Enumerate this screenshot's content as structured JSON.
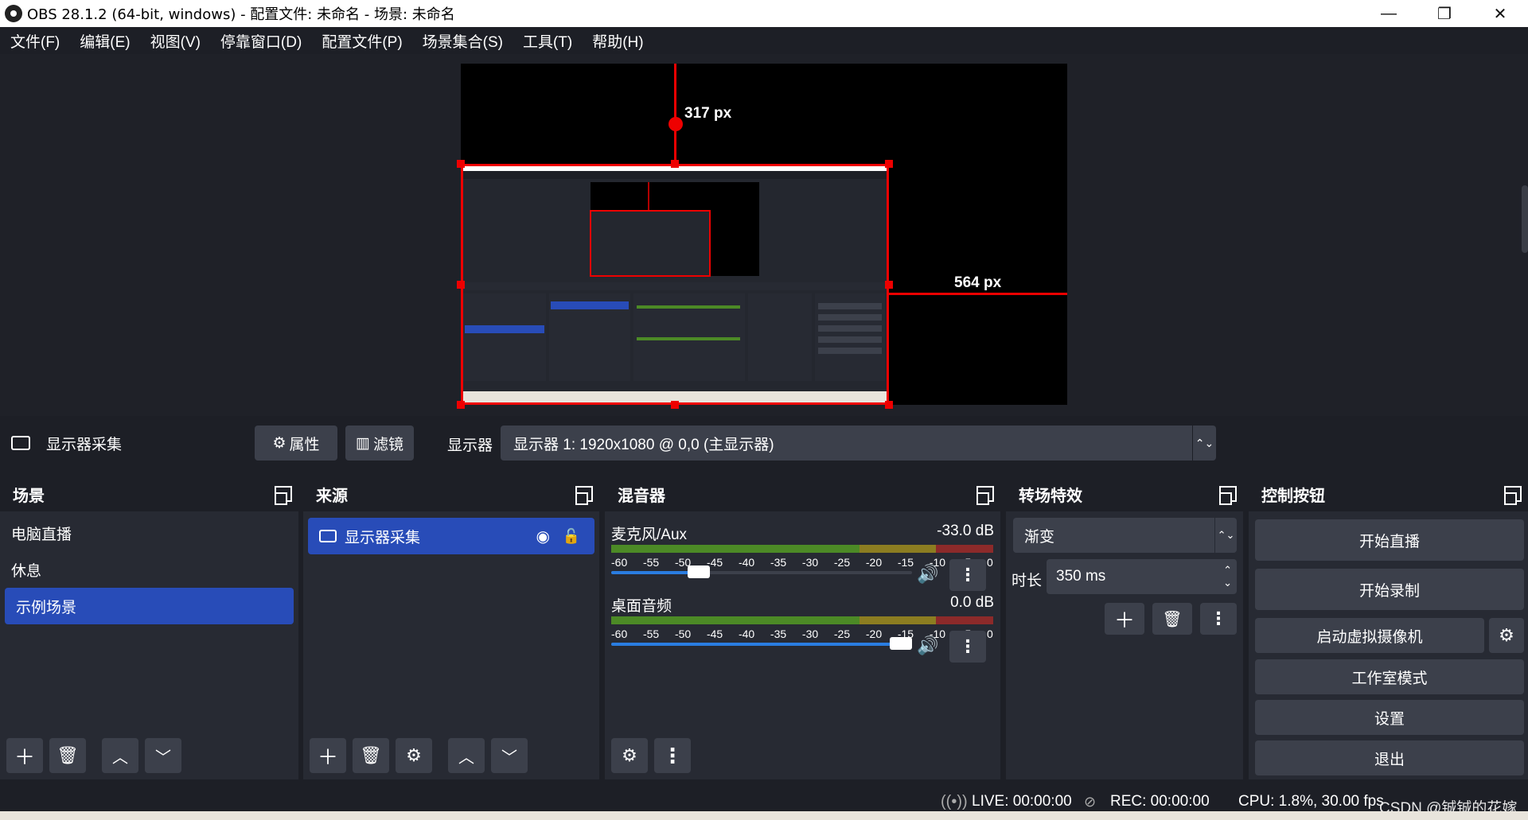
{
  "window": {
    "title": "OBS 28.1.2 (64-bit, windows) - 配置文件: 未命名 - 场景: 未命名",
    "minimize": "—",
    "maximize": "❐",
    "close": "✕"
  },
  "menu": [
    "文件(F)",
    "编辑(E)",
    "视图(V)",
    "停靠窗口(D)",
    "配置文件(P)",
    "场景集合(S)",
    "工具(T)",
    "帮助(H)"
  ],
  "preview": {
    "top_guide_label": "317 px",
    "right_guide_label": "564 px"
  },
  "source_toolbar": {
    "source_name": "显示器采集",
    "properties_label": "属性",
    "filters_label": "滤镜",
    "display_label": "显示器",
    "display_value": "显示器 1: 1920x1080 @ 0,0 (主显示器)"
  },
  "scenes": {
    "title": "场景",
    "items": [
      "电脑直播",
      "休息",
      "示例场景"
    ],
    "selected": "示例场景"
  },
  "sources": {
    "title": "来源",
    "items": [
      "显示器采集"
    ]
  },
  "mixer": {
    "title": "混音器",
    "scale": [
      "-60",
      "-55",
      "-50",
      "-45",
      "-40",
      "-35",
      "-30",
      "-25",
      "-20",
      "-15",
      "-10",
      "-5",
      "0"
    ],
    "channels": [
      {
        "name": "麦克风/Aux",
        "db": "-33.0 dB",
        "volume": 0.29
      },
      {
        "name": "桌面音频",
        "db": "0.0 dB",
        "volume": 1.0
      }
    ]
  },
  "transitions": {
    "title": "转场特效",
    "type": "渐变",
    "duration_label": "时长",
    "duration_value": "350 ms"
  },
  "controls": {
    "title": "控制按钮",
    "start_stream": "开始直播",
    "start_record": "开始录制",
    "virtual_cam": "启动虚拟摄像机",
    "studio_mode": "工作室模式",
    "settings": "设置",
    "exit": "退出"
  },
  "status": {
    "live": "LIVE: 00:00:00",
    "rec": "REC: 00:00:00",
    "cpu": "CPU: 1.8%, 30.00 fps"
  },
  "watermark": "CSDN @铖铖的花嫁",
  "colors": {
    "accent": "#284cb8",
    "guide_red": "#ee0000",
    "panel": "#272a33",
    "background": "#1d1f26",
    "button": "#3c404b"
  }
}
